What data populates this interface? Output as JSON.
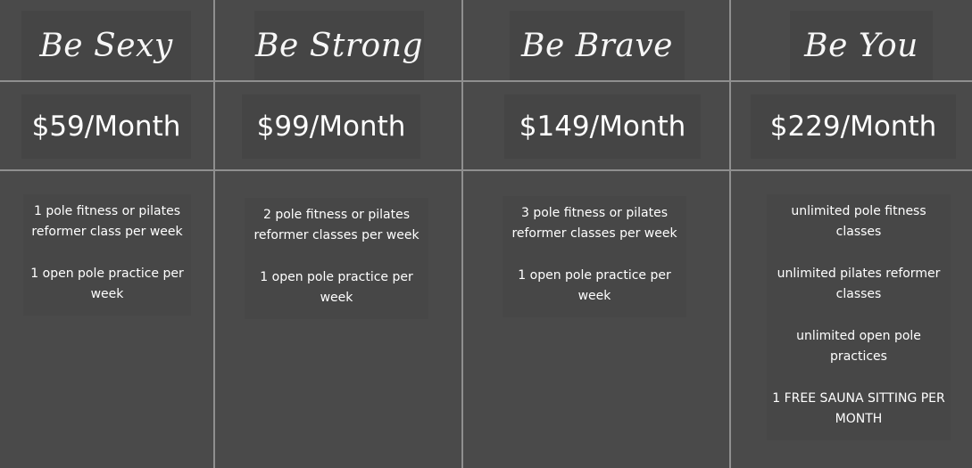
{
  "plans": [
    {
      "name": "Be Sexy",
      "price": "$59/Month",
      "features": [
        "1 pole fitness or pilates reformer class per week",
        "1 open pole practice per week"
      ]
    },
    {
      "name": "Be Strong",
      "price": "$99/Month",
      "features": [
        "2 pole fitness or pilates reformer classes per week",
        "1 open pole practice per week"
      ]
    },
    {
      "name": "Be Brave",
      "price": "$149/Month",
      "features": [
        "3 pole fitness or pilates reformer classes per week",
        "1 open pole practice per week"
      ]
    },
    {
      "name": "Be You",
      "price": "$229/Month",
      "features": [
        "unlimited pole fitness classes",
        "unlimited pilates reformer classes",
        "unlimited open pole practices",
        "1 FREE SAUNA SITTING PER MONTH"
      ]
    }
  ],
  "colors": {
    "background": "#4a4a4a",
    "divider": "#8f8f8f",
    "text": "#ffffff"
  }
}
